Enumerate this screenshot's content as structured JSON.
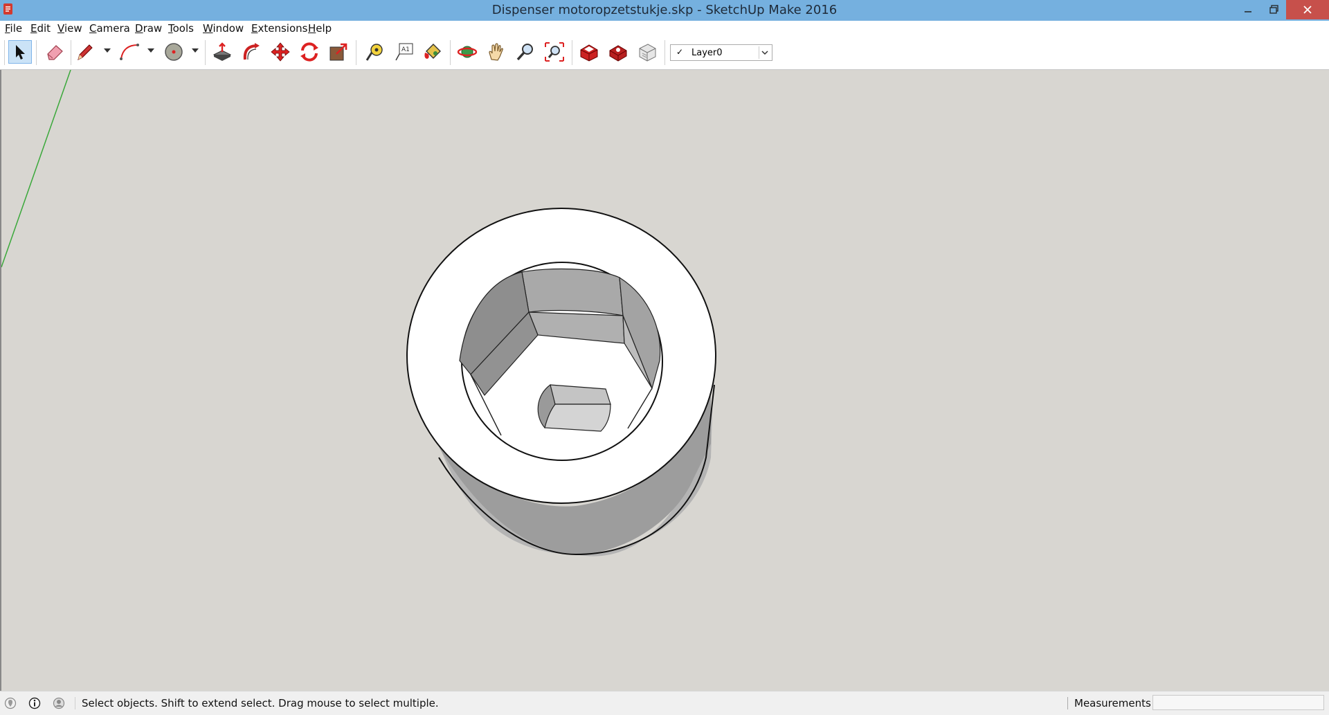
{
  "window": {
    "title": "Dispenser motoropzetstukje.skp - SketchUp Make 2016",
    "icon": "sketchup-app-icon",
    "controls": [
      "minimize-icon",
      "maximize-icon",
      "close-icon"
    ]
  },
  "menu": {
    "items": [
      "File",
      "Edit",
      "View",
      "Camera",
      "Draw",
      "Tools",
      "Window",
      "Extensions",
      "Help"
    ]
  },
  "toolbar": {
    "tools": [
      {
        "name": "select",
        "icon": "arrow-cursor-icon",
        "selected": true
      },
      {
        "name": "eraser",
        "icon": "eraser-icon"
      },
      {
        "name": "line",
        "icon": "pencil-icon",
        "dropdown": true
      },
      {
        "name": "arc",
        "icon": "arc-icon",
        "dropdown": true
      },
      {
        "name": "circle",
        "icon": "circle-icon",
        "dropdown": true
      },
      {
        "name": "push-pull",
        "icon": "push-pull-icon"
      },
      {
        "name": "follow-me",
        "icon": "follow-me-icon"
      },
      {
        "name": "move",
        "icon": "move-icon"
      },
      {
        "name": "rotate",
        "icon": "rotate-icon"
      },
      {
        "name": "scale",
        "icon": "scale-icon"
      },
      {
        "name": "tape-measure",
        "icon": "tape-measure-icon"
      },
      {
        "name": "text",
        "icon": "text-icon"
      },
      {
        "name": "paint-bucket",
        "icon": "paint-bucket-icon"
      },
      {
        "name": "orbit",
        "icon": "orbit-icon"
      },
      {
        "name": "pan",
        "icon": "pan-hand-icon"
      },
      {
        "name": "zoom",
        "icon": "zoom-icon"
      },
      {
        "name": "zoom-extents",
        "icon": "zoom-extents-icon"
      },
      {
        "name": "3d-warehouse",
        "icon": "warehouse-icon"
      },
      {
        "name": "extension-warehouse",
        "icon": "extension-warehouse-icon"
      },
      {
        "name": "send-to-layout",
        "icon": "layout-icon"
      }
    ],
    "layer": {
      "checked": true,
      "value": "Layer0"
    }
  },
  "status": {
    "icons": [
      "geo-location-icon",
      "credits-icon",
      "user-icon"
    ],
    "message": "Select objects. Shift to extend select. Drag mouse to select multiple.",
    "measurements_label": "Measurements",
    "measurements_value": ""
  },
  "colors": {
    "titlebar": "#75b0df",
    "viewport": "#d8d6d1",
    "close_button": "#c7504b",
    "green_axis": "#3aa83a"
  }
}
